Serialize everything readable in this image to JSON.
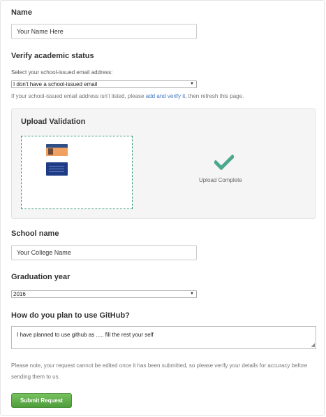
{
  "name": {
    "label": "Name",
    "value": "Your Name Here"
  },
  "verify": {
    "label": "Verify academic status",
    "select_label": "Select your school-issued email address:",
    "select_value": "I don't have a school-issued email",
    "hint_before": "If your school-issued email address isn't listed, please",
    "hint_link": "add and verify it",
    "hint_after": ", then refresh this page."
  },
  "upload": {
    "title": "Upload Validation",
    "status": "Upload Complete",
    "files": [
      "student-id-card-front",
      "student-id-card-back"
    ]
  },
  "school": {
    "label": "School name",
    "value": "Your College Name"
  },
  "graduation": {
    "label": "Graduation year",
    "value": "2016"
  },
  "usage": {
    "label": "How do you plan to use GitHub?",
    "value": "I have planned to use github as ..... fill the rest your self"
  },
  "note": "Please note, your request cannot be edited once it has been submitted, so please verify your details for accuracy before sending them to us.",
  "submit_label": "Submit Request",
  "colors": {
    "accent_link": "#4078c0",
    "check": "#4aa88d",
    "dropzone_border": "#3c9a7c",
    "submit": "#5cae47"
  }
}
